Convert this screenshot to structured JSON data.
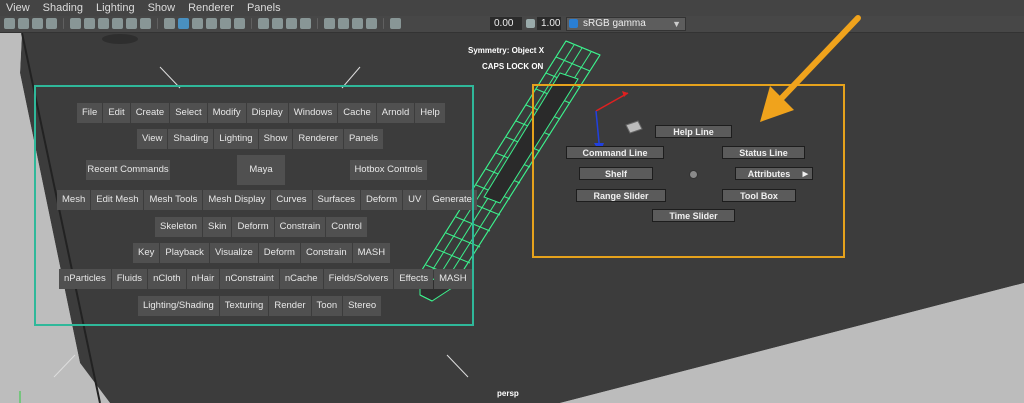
{
  "menubar": {
    "items": [
      "View",
      "Shading",
      "Lighting",
      "Show",
      "Renderer",
      "Panels"
    ]
  },
  "toolbar": {
    "field1": "0.00",
    "field2": "1.00",
    "color_space": "sRGB gamma"
  },
  "viewport": {
    "symmetry": "Symmetry: Object X",
    "caps": "CAPS LOCK ON",
    "camera": "persp"
  },
  "hotbox": {
    "row1": [
      "File",
      "Edit",
      "Create",
      "Select",
      "Modify",
      "Display",
      "Windows",
      "Cache",
      "Arnold",
      "Help"
    ],
    "row2": [
      "View",
      "Shading",
      "Lighting",
      "Show",
      "Renderer",
      "Panels"
    ],
    "row3": {
      "left": "Recent Commands",
      "center": "Maya",
      "right": "Hotbox Controls"
    },
    "row4": [
      "Mesh",
      "Edit Mesh",
      "Mesh Tools",
      "Mesh Display",
      "Curves",
      "Surfaces",
      "Deform",
      "UV",
      "Generate"
    ],
    "row5": [
      "Skeleton",
      "Skin",
      "Deform",
      "Constrain",
      "Control"
    ],
    "row6": [
      "Key",
      "Playback",
      "Visualize",
      "Deform",
      "Constrain",
      "MASH"
    ],
    "row7": [
      "nParticles",
      "Fluids",
      "nCloth",
      "nHair",
      "nConstraint",
      "nCache",
      "Fields/Solvers",
      "Effects",
      "MASH"
    ],
    "row8": [
      "Lighting/Shading",
      "Texturing",
      "Render",
      "Toon",
      "Stereo"
    ]
  },
  "marking_menu": {
    "north": "Help Line",
    "northwest": "Command Line",
    "northeast": "Status Line",
    "west": "Shelf",
    "east": "Attributes",
    "southwest": "Range Slider",
    "southeast": "Tool Box",
    "south": "Time Slider"
  },
  "colors": {
    "green_highlight": "#2fb89a",
    "orange_highlight": "#e6a21c",
    "wireframe": "#3cf08c"
  }
}
